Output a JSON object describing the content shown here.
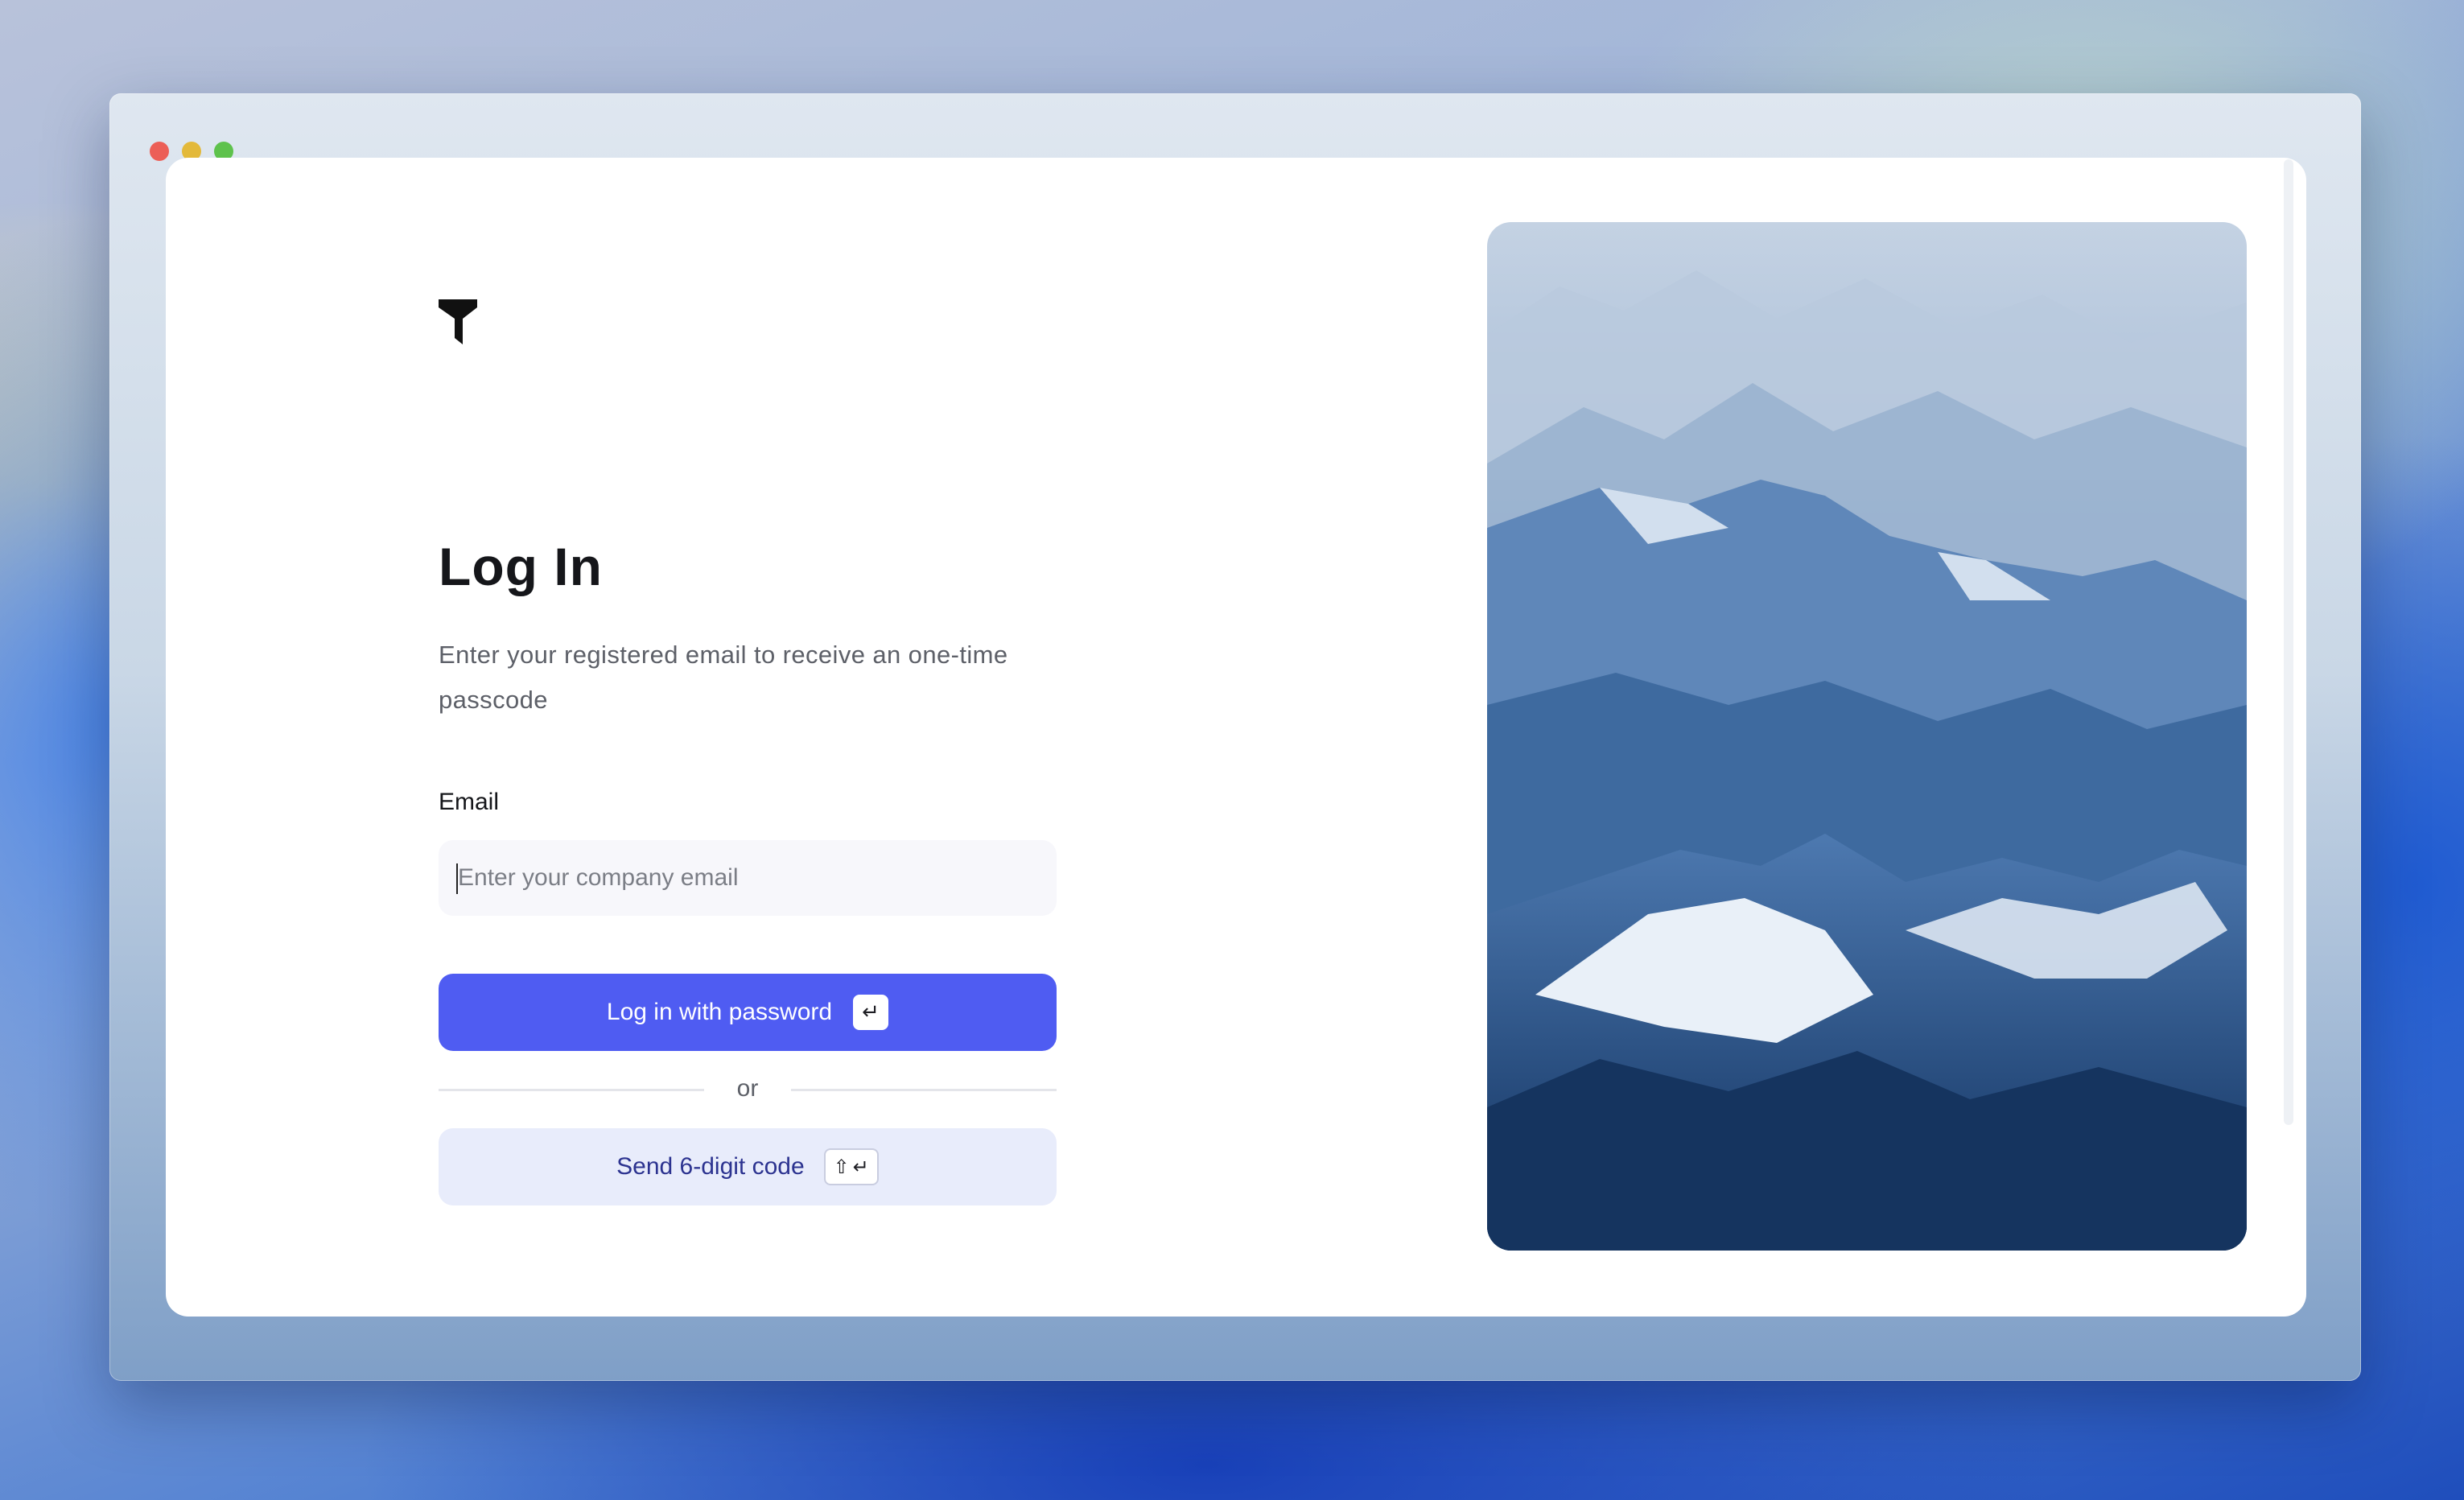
{
  "login": {
    "title": "Log In",
    "subtitle": "Enter your registered email to receive an one-time passcode",
    "email_label": "Email",
    "email_placeholder": "Enter your company email",
    "email_value": "",
    "password_button_label": "Log in with password",
    "password_button_shortcut": "↵",
    "divider_text": "or",
    "code_button_label": "Send 6-digit code",
    "code_button_shortcut_shift": "⇧",
    "code_button_shortcut_enter": "↵"
  },
  "icons": {
    "logo": "brand-logo-icon",
    "enter_key": "return-key-icon",
    "shift_key": "shift-key-icon"
  },
  "colors": {
    "primary": "#4F5CF2",
    "secondary_bg": "#E8ECFB",
    "secondary_text": "#2C3390",
    "input_bg": "#F7F7FB"
  },
  "hero_image": {
    "subject": "snow-mountain-range-photo"
  }
}
